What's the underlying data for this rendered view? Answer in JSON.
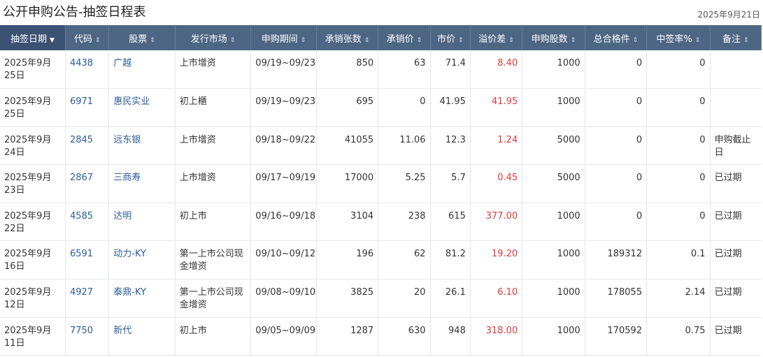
{
  "page": {
    "title": "公开申购公告-抽签日程表",
    "date": "2025年9月21日"
  },
  "columns": [
    {
      "label": "抽签日期",
      "sort": "▼"
    },
    {
      "label": "代码",
      "sort": "⇕"
    },
    {
      "label": "股票",
      "sort": "⇕"
    },
    {
      "label": "发行市场",
      "sort": "⇕"
    },
    {
      "label": "申购期间",
      "sort": "⇕"
    },
    {
      "label": "承销张数",
      "sort": "⇕"
    },
    {
      "label": "承销价",
      "sort": "⇕"
    },
    {
      "label": "市价",
      "sort": "⇕"
    },
    {
      "label": "溢价差",
      "sort": "⇕"
    },
    {
      "label": "申购股数",
      "sort": "⇕"
    },
    {
      "label": "总合格件",
      "sort": "⇕"
    },
    {
      "label": "中签率%",
      "sort": "⇕"
    },
    {
      "label": "备注",
      "sort": "⇕"
    }
  ],
  "rows": [
    {
      "date": "2025年9月25日",
      "code": "4438",
      "stock": "广越",
      "market": "上市增资",
      "period": "09/19~09/23",
      "lots": "850",
      "price": "63",
      "market_price": "71.4",
      "spread": "8.40",
      "shares": "1000",
      "qualified": "0",
      "rate": "0",
      "note": ""
    },
    {
      "date": "2025年9月25日",
      "code": "6971",
      "stock": "惠民实业",
      "market": "初上櫃",
      "period": "09/19~09/23",
      "lots": "695",
      "price": "0",
      "market_price": "41.95",
      "spread": "41.95",
      "shares": "1000",
      "qualified": "0",
      "rate": "0",
      "note": ""
    },
    {
      "date": "2025年9月24日",
      "code": "2845",
      "stock": "远东银",
      "market": "上市增资",
      "period": "09/18~09/22",
      "lots": "41055",
      "price": "11.06",
      "market_price": "12.3",
      "spread": "1.24",
      "shares": "5000",
      "qualified": "0",
      "rate": "0",
      "note": "申购截止日"
    },
    {
      "date": "2025年9月23日",
      "code": "2867",
      "stock": "三商寿",
      "market": "上市增资",
      "period": "09/17~09/19",
      "lots": "17000",
      "price": "5.25",
      "market_price": "5.7",
      "spread": "0.45",
      "shares": "5000",
      "qualified": "0",
      "rate": "0",
      "note": "已过期"
    },
    {
      "date": "2025年9月22日",
      "code": "4585",
      "stock": "达明",
      "market": "初上市",
      "period": "09/16~09/18",
      "lots": "3104",
      "price": "238",
      "market_price": "615",
      "spread": "377.00",
      "shares": "1000",
      "qualified": "0",
      "rate": "0",
      "note": "已过期"
    },
    {
      "date": "2025年9月16日",
      "code": "6591",
      "stock": "动力-KY",
      "market": "第一上市公司现金增资",
      "period": "09/10~09/12",
      "lots": "196",
      "price": "62",
      "market_price": "81.2",
      "spread": "19.20",
      "shares": "1000",
      "qualified": "189312",
      "rate": "0.1",
      "note": "已过期"
    },
    {
      "date": "2025年9月12日",
      "code": "4927",
      "stock": "泰鼎-KY",
      "market": "第一上市公司现金增资",
      "period": "09/08~09/10",
      "lots": "3825",
      "price": "20",
      "market_price": "26.1",
      "spread": "6.10",
      "shares": "1000",
      "qualified": "178055",
      "rate": "2.14",
      "note": "已过期"
    },
    {
      "date": "2025年9月11日",
      "code": "7750",
      "stock": "新代",
      "market": "初上市",
      "period": "09/05~09/09",
      "lots": "1287",
      "price": "630",
      "market_price": "948",
      "spread": "318.00",
      "shares": "1000",
      "qualified": "170592",
      "rate": "0.75",
      "note": "已过期"
    }
  ]
}
